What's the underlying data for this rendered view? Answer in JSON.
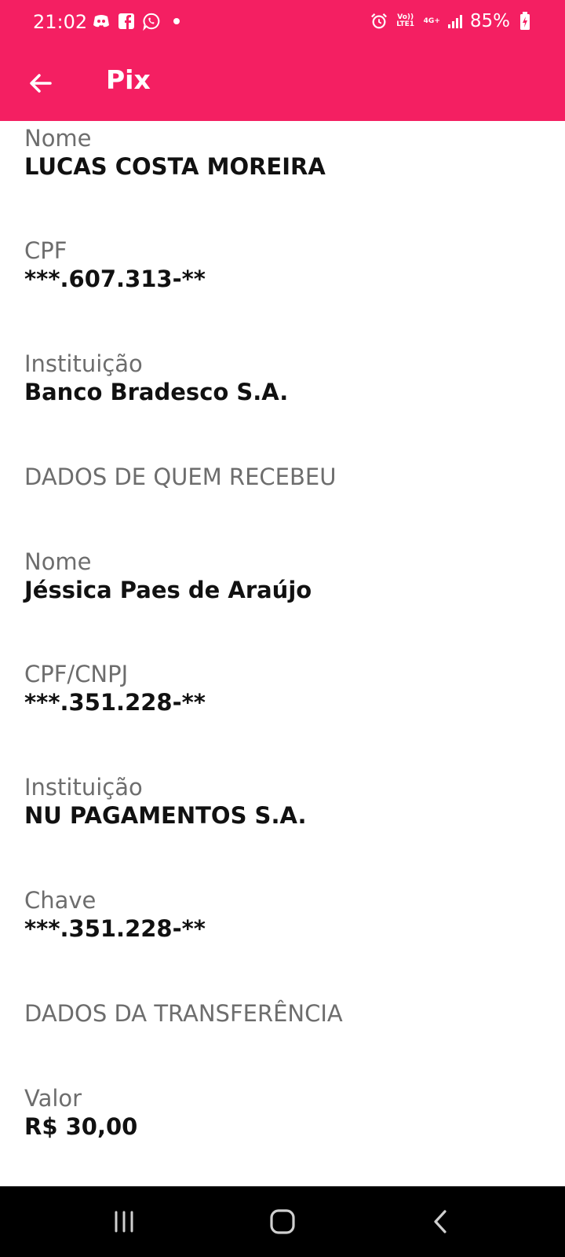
{
  "status_bar": {
    "time": "21:02",
    "battery": "85%",
    "network_top": "Vo)) LTE1",
    "network_type": "4G+",
    "icons": [
      "discord-icon",
      "facebook-icon",
      "whatsapp-icon",
      "notification-dot-icon",
      "alarm-icon",
      "signal-icon",
      "battery-charging-icon"
    ]
  },
  "app_bar": {
    "title": "Pix",
    "back_icon": "arrow-left-icon"
  },
  "payer": {
    "name_label": "Nome",
    "name_value": "LUCAS COSTA MOREIRA",
    "cpf_label": "CPF",
    "cpf_value": "***.607.313-**",
    "institution_label": "Instituição",
    "institution_value": "Banco Bradesco S.A."
  },
  "receiver": {
    "section_title": "DADOS DE QUEM RECEBEU",
    "name_label": "Nome",
    "name_value": "Jéssica Paes de Araújo",
    "doc_label": "CPF/CNPJ",
    "doc_value": "***.351.228-**",
    "institution_label": "Instituição",
    "institution_value": "NU PAGAMENTOS S.A.",
    "key_label": "Chave",
    "key_value": "***.351.228-**"
  },
  "transfer": {
    "section_title": "DADOS DA TRANSFERÊNCIA",
    "amount_label": "Valor",
    "amount_value": "R$ 30,00"
  },
  "colors": {
    "brand": "#f41f62",
    "label": "#6d6d6d",
    "value": "#111111"
  },
  "nav_bar": {
    "icons": [
      "recent-apps-icon",
      "home-icon",
      "back-icon"
    ]
  }
}
